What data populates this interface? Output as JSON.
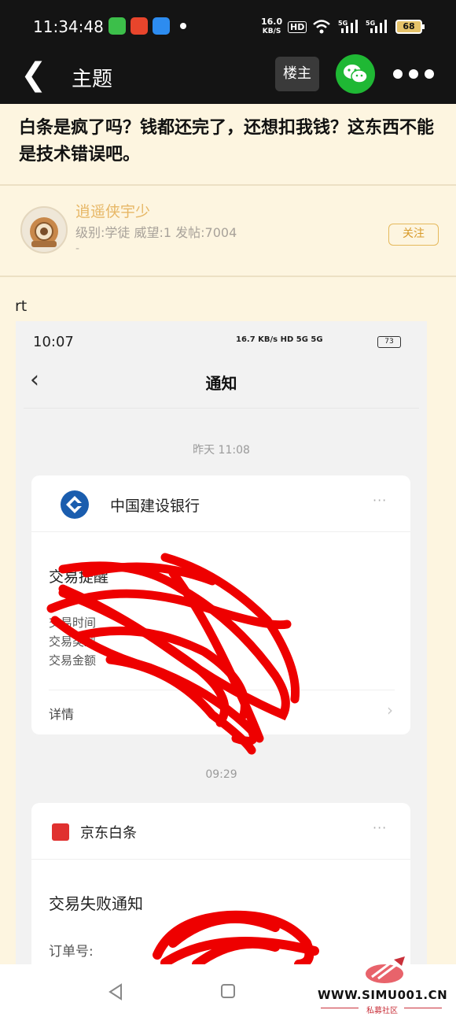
{
  "status_bar": {
    "time": "11:34:48",
    "net_speed": "16.0",
    "net_unit": "KB/S",
    "hd_badge": "HD",
    "battery": "68"
  },
  "nav": {
    "back_icon": "back-arrow-icon",
    "title": "主题",
    "author_button": "楼主",
    "wechat_icon": "wechat-icon",
    "more_icon": "more-dots-icon"
  },
  "topic": {
    "title": "白条是疯了吗？钱都还完了，还想扣我钱？这东西不能是技术错误吧。"
  },
  "author": {
    "name": "逍遥侠宇少",
    "info": "级别:学徒 威望:1 发帖:7004",
    "signature": "-",
    "follow_label": "关注"
  },
  "post": {
    "text": "rt"
  },
  "screenshot": {
    "time": "10:07",
    "status_text": "16.7 KB/s  HD  5G  5G",
    "battery": "73",
    "title": "通知",
    "back_icon": "back-chevron-icon",
    "group1_time": "昨天 11:08",
    "card1": {
      "bank": "中国建设银行",
      "more": "···",
      "heading": "交易提醒",
      "row1": "交易时间",
      "row2": "交易类型",
      "row3": "交易金额",
      "detail": "详情"
    },
    "group2_time": "09:29",
    "card2": {
      "name": "京东白条",
      "more": "···",
      "heading": "交易失败通知",
      "row1": "订单号:"
    }
  },
  "watermark": {
    "site": "WWW.SIMU001.CN",
    "sub": "私募社区"
  },
  "colors": {
    "bg": "#fdf5e0",
    "bar": "#141414",
    "accent": "#e7b766",
    "wechat": "#1fb834",
    "scribble": "#ee0000"
  }
}
